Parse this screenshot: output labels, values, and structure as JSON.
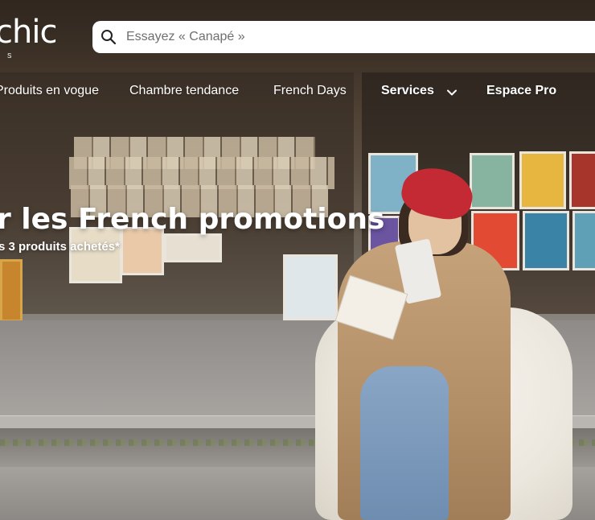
{
  "brand": {
    "logo_text": "chic",
    "logo_sub": "S"
  },
  "search": {
    "placeholder": "Essayez « Canapé »",
    "icon": "search-icon"
  },
  "nav": {
    "items": [
      {
        "label": "Produits en vogue"
      },
      {
        "label": "Chambre tendance"
      },
      {
        "label": "French Days"
      },
      {
        "label": "Services"
      },
      {
        "label": "Espace Pro"
      }
    ],
    "services_icon": "chevron-down-icon"
  },
  "hero": {
    "headline": "r les French promotions",
    "subline": "s 3 produits achetés*"
  },
  "colors": {
    "text_on_image": "#ffffff",
    "search_bg": "#ffffff",
    "beret": "#c32a33",
    "coat": "#b38f67"
  }
}
